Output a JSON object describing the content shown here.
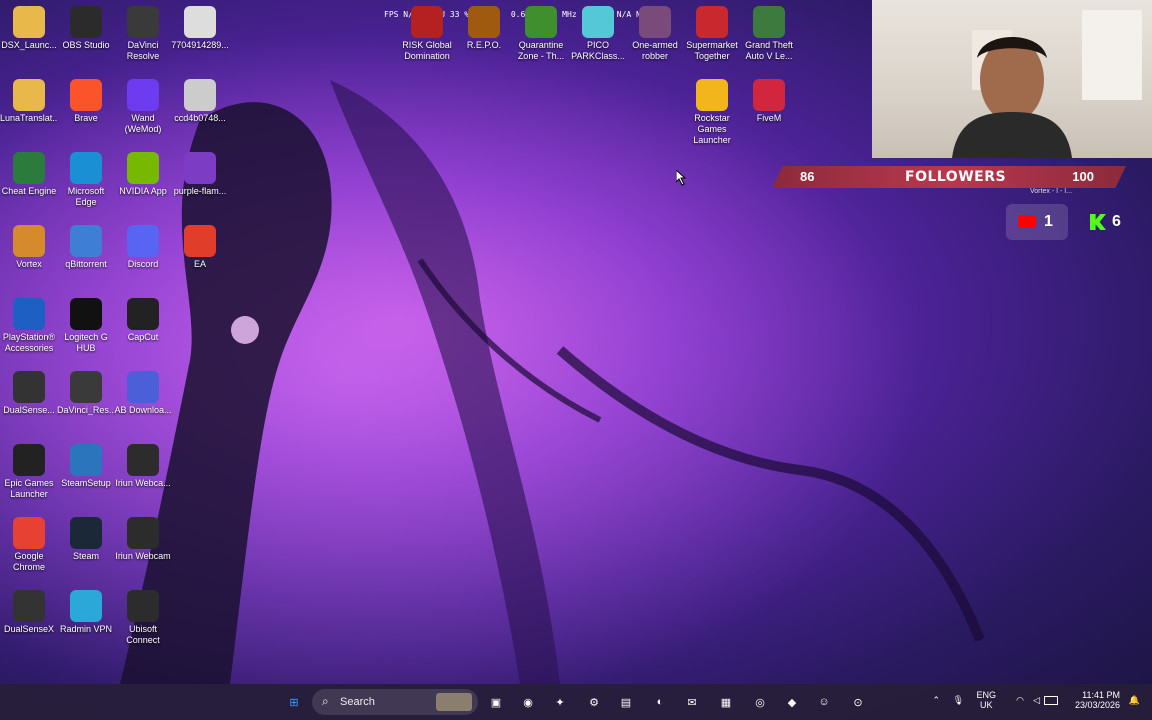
{
  "hud": {
    "fps": "FPS  N/A",
    "gpu": "GPU  33 %  51 °C",
    "mem": "0.630",
    "clock": "05 MHz",
    "cpu": "3 %",
    "other": "N/A  N/A"
  },
  "desktop_icons": [
    {
      "label": "DSX_Launc...",
      "icon": "folder-icon",
      "color": "#e8b84a"
    },
    {
      "label": "OBS Studio",
      "icon": "obs-icon",
      "color": "#2b2b2b"
    },
    {
      "label": "DaVinci Resolve",
      "icon": "davinci-icon",
      "color": "#3a3a3a"
    },
    {
      "label": "7704914289...",
      "icon": "image-file-icon",
      "color": "#ddd"
    },
    {
      "label": "LunaTranslat...",
      "icon": "folder-icon",
      "color": "#e8b84a"
    },
    {
      "label": "Brave",
      "icon": "brave-icon",
      "color": "#fb542b"
    },
    {
      "label": "Wand (WeMod)",
      "icon": "wand-icon",
      "color": "#6d3cf0"
    },
    {
      "label": "ccd4b0748...",
      "icon": "image-file-icon",
      "color": "#ccc"
    },
    {
      "label": "Cheat Engine",
      "icon": "cheat-engine-icon",
      "color": "#2a7b3c"
    },
    {
      "label": "Microsoft Edge",
      "icon": "edge-icon",
      "color": "#1b8fd4"
    },
    {
      "label": "NVIDIA App",
      "icon": "nvidia-icon",
      "color": "#76b900"
    },
    {
      "label": "purple-flam...",
      "icon": "image-file-icon",
      "color": "#7c3cc4"
    },
    {
      "label": "Vortex",
      "icon": "vortex-icon",
      "color": "#d58b2b"
    },
    {
      "label": "qBittorrent",
      "icon": "qbittorrent-icon",
      "color": "#3e7fd5"
    },
    {
      "label": "Discord",
      "icon": "discord-icon",
      "color": "#5865f2"
    },
    {
      "label": "EA",
      "icon": "ea-icon",
      "color": "#e03d2b"
    },
    {
      "label": "PlayStation® Accessories",
      "icon": "playstation-icon",
      "color": "#1d5fc2"
    },
    {
      "label": "Logitech G HUB",
      "icon": "logitech-icon",
      "color": "#111"
    },
    {
      "label": "CapCut",
      "icon": "capcut-icon",
      "color": "#222"
    },
    {
      "label": "DualSense...",
      "icon": "controller-icon",
      "color": "#333"
    },
    {
      "label": "DaVinci_Res...",
      "icon": "davinci-icon",
      "color": "#3a3a3a"
    },
    {
      "label": "AB Downloa...",
      "icon": "download-icon",
      "color": "#4b5fd8"
    },
    {
      "label": "Epic Games Launcher",
      "icon": "epic-icon",
      "color": "#222"
    },
    {
      "label": "SteamSetup",
      "icon": "steam-setup-icon",
      "color": "#2a75bb"
    },
    {
      "label": "Iriun Webca...",
      "icon": "iriun-icon",
      "color": "#2c2c2c"
    },
    {
      "label": "Google Chrome",
      "icon": "chrome-icon",
      "color": "#e74133"
    },
    {
      "label": "Steam",
      "icon": "steam-icon",
      "color": "#1b2838"
    },
    {
      "label": "Iriun Webcam",
      "icon": "iriun-icon",
      "color": "#2c2c2c"
    },
    {
      "label": "DualSenseX",
      "icon": "controller-icon",
      "color": "#333"
    },
    {
      "label": "Radmin VPN",
      "icon": "radmin-icon",
      "color": "#2aa9d8"
    },
    {
      "label": "Ubisoft Connect",
      "icon": "ubisoft-icon",
      "color": "#2c2c2c"
    }
  ],
  "top_icons": [
    {
      "label": "RISK Global Domination",
      "icon": "risk-icon",
      "color": "#b52020"
    },
    {
      "label": "R.E.P.O.",
      "icon": "repo-icon",
      "color": "#a05a10"
    },
    {
      "label": "Quarantine Zone - Th...",
      "icon": "quarantine-icon",
      "color": "#3f8f2f"
    },
    {
      "label": "PICO PARKClass...",
      "icon": "pico-park-icon",
      "color": "#55c8d8"
    },
    {
      "label": "One-armed robber",
      "icon": "one-armed-robber-icon",
      "color": "#7a4b7a"
    },
    {
      "label": "Supermarket Together",
      "icon": "supermarket-icon",
      "color": "#c8282e"
    },
    {
      "label": "Grand Theft Auto V Le...",
      "icon": "gta-icon",
      "color": "#3d7a3d"
    },
    {
      "label": "Rockstar Games Launcher",
      "icon": "rockstar-icon",
      "color": "#f2b51c"
    },
    {
      "label": "FiveM",
      "icon": "fivem-icon",
      "color": "#d2263f"
    }
  ],
  "stream_overlay": {
    "followers_current": "86",
    "followers_label": "FOLLOWERS",
    "followers_goal": "100",
    "progress_fraction": 0.86,
    "overlay_caption": "Vortex - I - I...",
    "youtube_count": "1",
    "kick_count": "6"
  },
  "taskbar": {
    "search_placeholder": "Search",
    "apps": [
      {
        "icon": "start-icon"
      },
      {
        "icon": "task-view-icon"
      },
      {
        "icon": "chrome-icon"
      },
      {
        "icon": "copilot-icon"
      },
      {
        "icon": "cheat-engine-icon"
      },
      {
        "icon": "file-explorer-icon"
      },
      {
        "icon": "edge-icon"
      },
      {
        "icon": "outlook-icon"
      },
      {
        "icon": "store-icon"
      },
      {
        "icon": "obs-icon"
      },
      {
        "icon": "purple-app-icon"
      },
      {
        "icon": "discord-icon"
      },
      {
        "icon": "steam-icon"
      }
    ],
    "lang": "ENG",
    "region": "UK",
    "time": "11:41 PM",
    "date": "23/03/2026"
  }
}
